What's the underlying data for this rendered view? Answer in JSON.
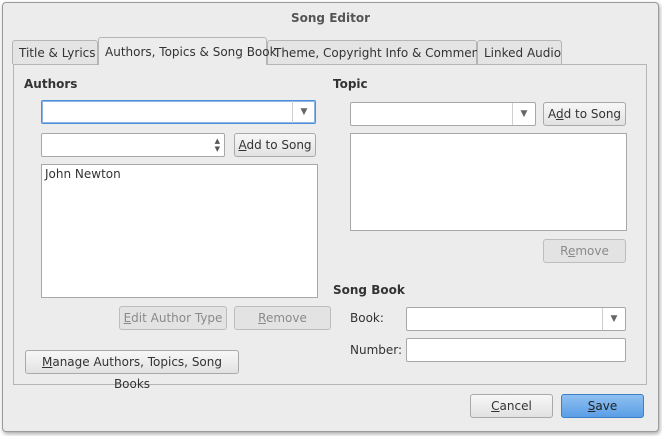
{
  "window": {
    "title": "Song Editor"
  },
  "tabs": [
    {
      "label": "Title & Lyrics"
    },
    {
      "label": "Authors, Topics & Song Book"
    },
    {
      "label": "Theme, Copyright Info & Comments"
    },
    {
      "label": "Linked Audio"
    }
  ],
  "active_tab": 1,
  "authors": {
    "heading": "Authors",
    "author_combo_value": "",
    "author_type_value": "",
    "add_button": {
      "mnemonic": "A",
      "rest": "dd to Song"
    },
    "list": [
      "John Newton"
    ],
    "edit_type_button": {
      "mnemonic": "E",
      "rest": "dit Author Type"
    },
    "remove_button": {
      "mnemonic": "R",
      "rest": "emove"
    }
  },
  "manage_button": {
    "mnemonic": "M",
    "rest": "anage Authors, Topics, Song Books"
  },
  "topic": {
    "heading": "Topic",
    "combo_value": "",
    "add_button": {
      "prefix": "A",
      "mnemonic": "d",
      "rest": "d to Song"
    },
    "list": [],
    "remove_button": {
      "prefix": "R",
      "mnemonic": "e",
      "rest": "move"
    }
  },
  "song_book": {
    "heading": "Song Book",
    "book_label": "Book:",
    "book_value": "",
    "number_label": "Number:",
    "number_value": ""
  },
  "footer": {
    "cancel_button": {
      "mnemonic": "C",
      "rest": "ancel"
    },
    "save_button": {
      "mnemonic": "S",
      "rest": "ave"
    }
  },
  "colors": {
    "accent": "#5a9ee6",
    "focus": "#4a90d9"
  }
}
